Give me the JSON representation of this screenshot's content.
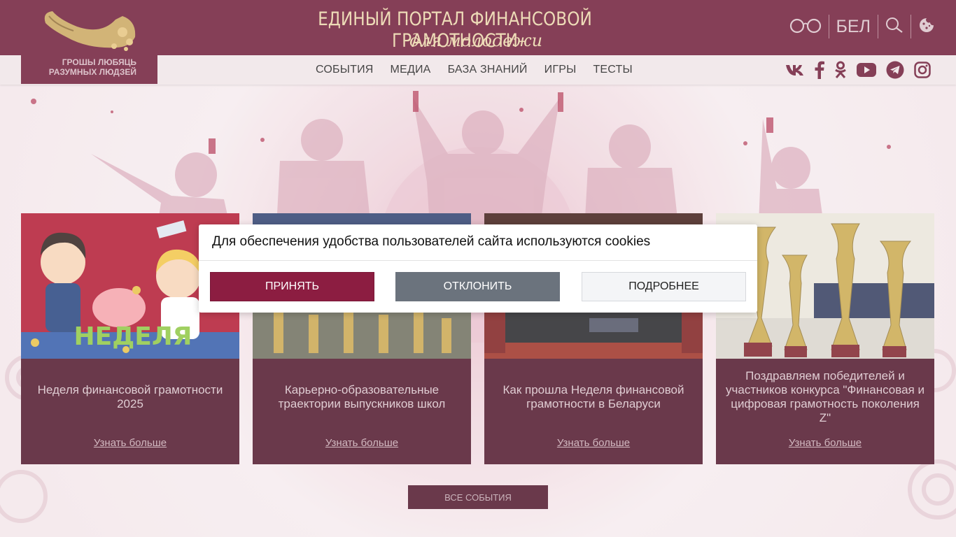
{
  "header": {
    "logo_text_line1": "ГРОШЫ ЛЮБЯЦЬ",
    "logo_text_line2": "РАЗУМНЫХ ЛЮДЗЕЙ",
    "title": "ЕДИНЫЙ ПОРТАЛ ФИНАНСОВОЙ ГРАМОТНОСТИ",
    "subtitle": "для молодежи",
    "language": "БЕЛ",
    "icons": [
      "glasses-icon",
      "search-icon",
      "cookie-icon"
    ]
  },
  "nav": {
    "items": [
      "СОБЫТИЯ",
      "МЕДИА",
      "БАЗА ЗНАНИЙ",
      "ИГРЫ",
      "ТЕСТЫ"
    ],
    "social": [
      "vk-icon",
      "facebook-icon",
      "odnoklassniki-icon",
      "youtube-icon",
      "telegram-icon",
      "instagram-icon"
    ]
  },
  "cards": [
    {
      "title": "Неделя финансовой грамотности 2025",
      "link": "Узнать больше",
      "image_text": "НЕДЕЛЯ"
    },
    {
      "title": "Карьерно-образовательные траектории выпускников школ",
      "link": "Узнать больше"
    },
    {
      "title": "Как прошла Неделя финансовой грамотности в Беларуси",
      "link": "Узнать больше"
    },
    {
      "title": "Поздравляем победителей и участников конкурса \"Финансовая и цифровая грамотность поколения Z\"",
      "link": "Узнать больше"
    }
  ],
  "all_events_button": "ВСЕ СОБЫТИЯ",
  "cookie_dialog": {
    "text": "Для обеспечения удобства пользователей сайта используются cookies",
    "accept": "ПРИНЯТЬ",
    "decline": "ОТКЛОНИТЬ",
    "more": "ПОДРОБНЕЕ"
  },
  "colors": {
    "brand": "#6b1533",
    "card_bg": "#4a0e24",
    "accept": "#8c1d41",
    "decline": "#6b737d"
  }
}
